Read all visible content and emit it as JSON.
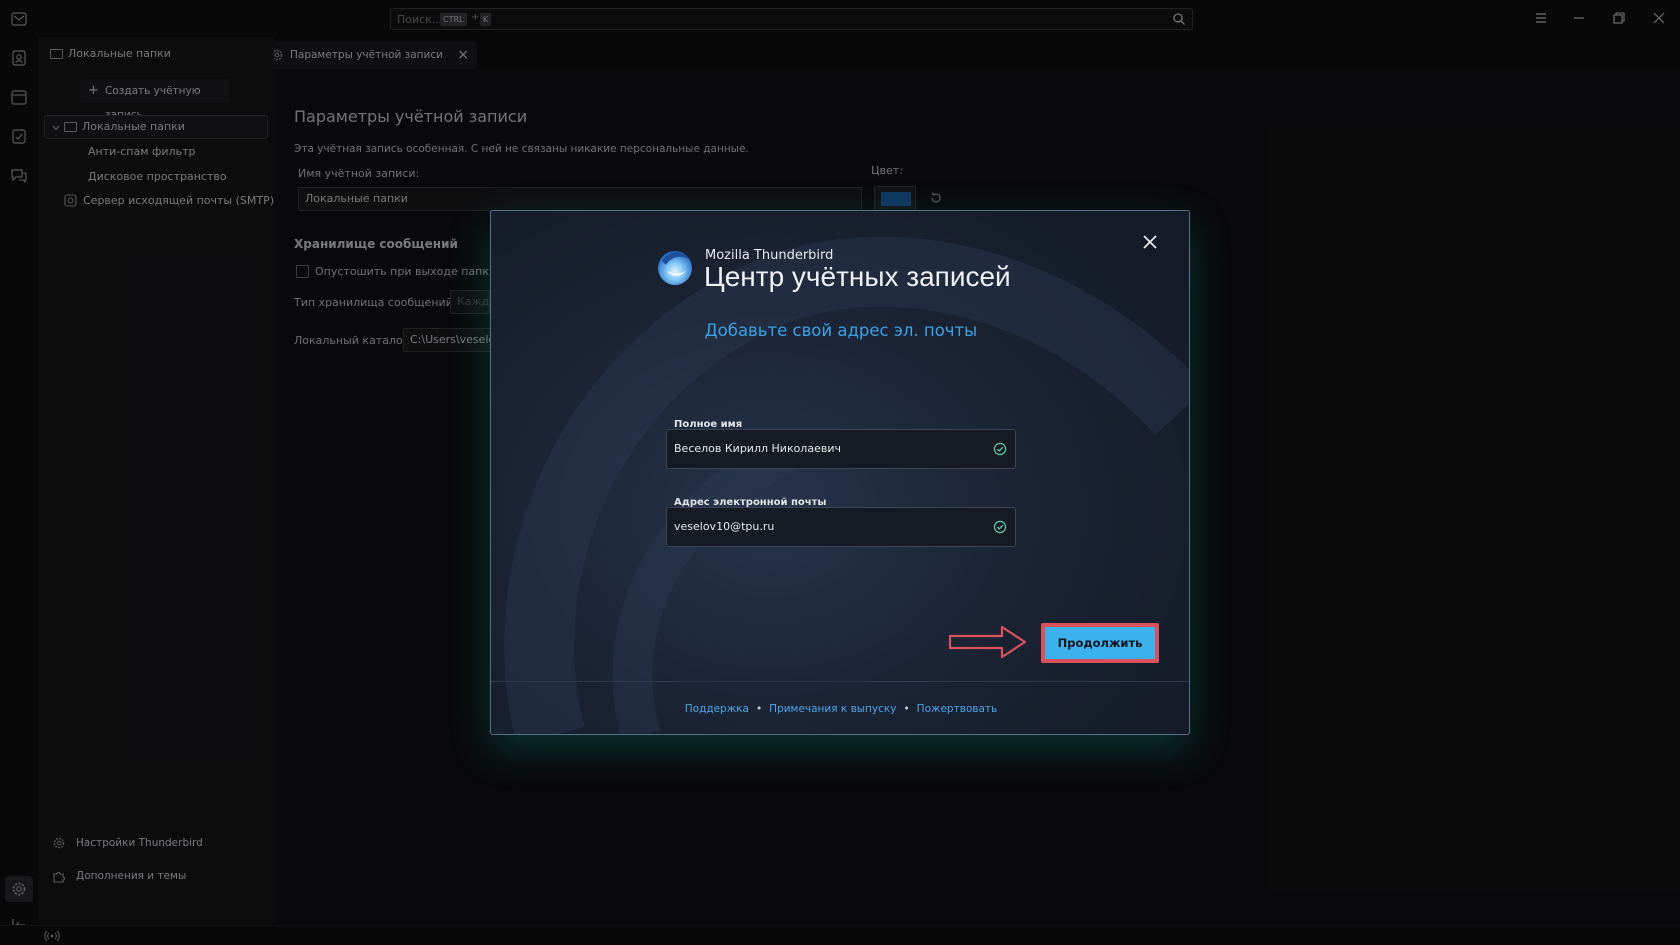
{
  "titlebar": {
    "search_placeholder": "Поиск...",
    "kbd_ctrl": "CTRL",
    "kbd_plus": "+",
    "kbd_k": "K"
  },
  "tabs": {
    "folders_label": "Локальные папки",
    "account_label": "Параметры учётной записи"
  },
  "sidebar": {
    "create_account": "Создать учётную запись",
    "tree": [
      {
        "label": "Локальные папки"
      },
      {
        "label": "Анти-спам фильтр"
      },
      {
        "label": "Дисковое пространство"
      },
      {
        "label": "Сервер исходящей почты (SMTP)"
      }
    ],
    "settings": "Настройки Thunderbird",
    "addons": "Дополнения и темы"
  },
  "account_settings": {
    "heading": "Параметры учётной записи",
    "description": "Эта учётная запись особенная. С ней не связаны никакие персональные данные.",
    "name_label": "Имя учётной записи:",
    "name_value": "Локальные папки",
    "color_label": "Цвет:",
    "color_value": "#1d5fa8",
    "storage_heading": "Хранилище сообщений",
    "empty_on_exit": "Опустошить при выходе папку «",
    "store_type_label": "Тип хранилища сообщений:",
    "store_type_value": "Кажд",
    "local_dir_label": "Локальный каталог:",
    "local_dir_value": "C:\\Users\\veselov"
  },
  "dialog": {
    "brand": "Mozilla Thunderbird",
    "title": "Центр учётных записей",
    "subtitle": "Добавьте свой адрес эл. почты",
    "full_name_label": "Полное имя",
    "full_name_value": "Веселов Кирилл Николаевич",
    "email_label": "Адрес электронной почты",
    "email_value": "veselov10@tpu.ru",
    "continue": "Продолжить",
    "footer": {
      "support": "Поддержка",
      "release_notes": "Примечания к выпуску",
      "donate": "Пожертвовать",
      "separator": "•"
    }
  },
  "colors": {
    "accent": "#3db1ec",
    "link": "#4aa5e6",
    "highlight": "#d9525b",
    "valid": "#5fc9a8"
  },
  "icons": [
    "mail-icon",
    "address-book-icon",
    "calendar-icon",
    "tasks-icon",
    "chat-icon",
    "gear-icon",
    "collapse-icon",
    "search-icon",
    "menu-icon",
    "minimize-icon",
    "restore-icon",
    "close-icon",
    "folder-icon",
    "check-icon",
    "arrow-icon",
    "thunderbird-logo-icon"
  ]
}
